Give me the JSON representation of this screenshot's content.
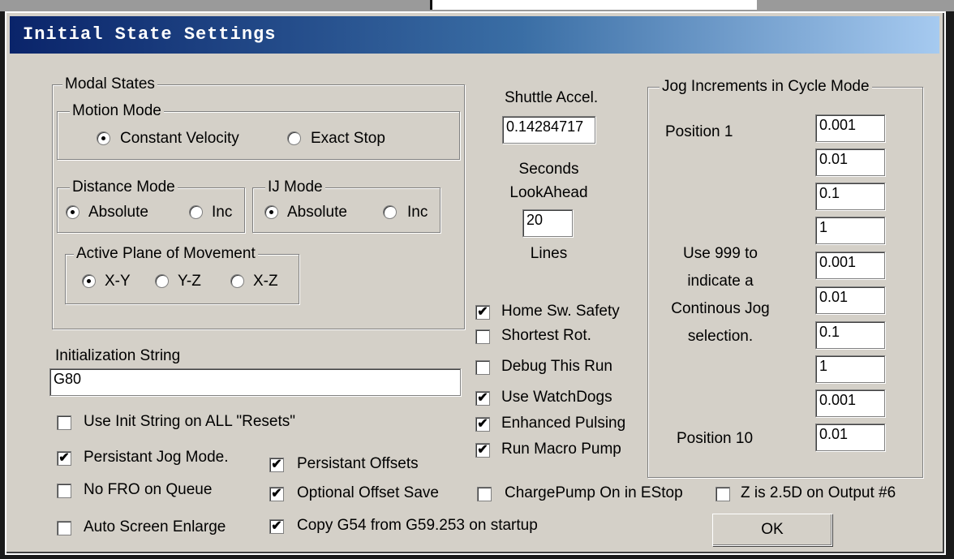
{
  "dialog": {
    "title": "Initial State Settings"
  },
  "modal_states": {
    "legend": "Modal States",
    "motion_mode": {
      "legend": "Motion Mode",
      "options": [
        "Constant Velocity",
        "Exact Stop"
      ],
      "selected": "Constant Velocity"
    },
    "distance_mode": {
      "legend": "Distance Mode",
      "options": [
        "Absolute",
        "Inc"
      ],
      "selected": "Absolute"
    },
    "ij_mode": {
      "legend": "IJ Mode",
      "options": [
        "Absolute",
        "Inc"
      ],
      "selected": "Absolute"
    },
    "active_plane": {
      "legend": "Active Plane of Movement",
      "options": [
        "X-Y",
        "Y-Z",
        "X-Z"
      ],
      "selected": "X-Y"
    }
  },
  "init": {
    "label": "Initialization String",
    "value": "G80",
    "use_all_resets": {
      "label": "Use Init String on ALL  \"Resets\"",
      "checked": false
    }
  },
  "shuttle": {
    "label": "Shuttle Accel.",
    "value": "0.14284717",
    "units": "Seconds"
  },
  "lookahead": {
    "label": "LookAhead",
    "value": "20",
    "units": "Lines"
  },
  "mid_checks": [
    {
      "label": "Home Sw. Safety",
      "checked": true
    },
    {
      "label": "Shortest Rot.",
      "checked": false
    },
    {
      "label": "Debug This Run",
      "checked": false
    },
    {
      "label": "Use WatchDogs",
      "checked": true
    },
    {
      "label": "Enhanced Pulsing",
      "checked": true
    },
    {
      "label": "Run Macro Pump",
      "checked": true
    }
  ],
  "bottom_checks": {
    "persist_jog": {
      "label": "Persistant Jog Mode.",
      "checked": true
    },
    "persist_offsets": {
      "label": "Persistant Offsets",
      "checked": true
    },
    "no_fro": {
      "label": "No FRO on Queue",
      "checked": false
    },
    "optional_offset": {
      "label": "Optional Offset Save",
      "checked": true
    },
    "chargepump": {
      "label": "ChargePump On in EStop",
      "checked": false
    },
    "z_25d": {
      "label": "Z is 2.5D on Output #6",
      "checked": false
    },
    "auto_enlarge": {
      "label": "Auto Screen Enlarge",
      "checked": false
    },
    "copy_g54": {
      "label": "Copy G54 from G59.253 on startup",
      "checked": true
    }
  },
  "jog": {
    "legend": "Jog Increments in Cycle Mode",
    "pos1_label": "Position 1",
    "pos10_label": "Position 10",
    "hint": [
      "Use 999 to",
      "indicate a",
      "Continous Jog",
      "selection."
    ],
    "values": [
      "0.001",
      "0.01",
      "0.1",
      "1",
      "0.001",
      "0.01",
      "0.1",
      "1",
      "0.001",
      "0.01"
    ]
  },
  "ok_label": "OK",
  "check_mark": "✔"
}
